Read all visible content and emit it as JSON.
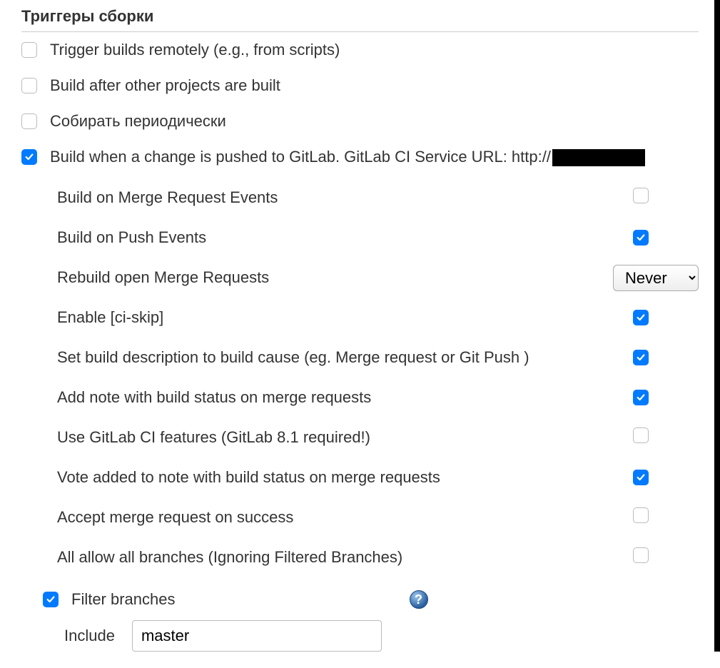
{
  "section_title": "Триггеры сборки",
  "triggers": {
    "remote": {
      "label": "Trigger builds remotely (e.g., from scripts)",
      "checked": false
    },
    "after_projects": {
      "label": "Build after other projects are built",
      "checked": false
    },
    "periodic": {
      "label": "Собирать периодически",
      "checked": false
    },
    "gitlab_push": {
      "label": "Build when a change is pushed to GitLab. GitLab CI Service URL: http://",
      "checked": true
    }
  },
  "gitlab_options": {
    "mr_events": {
      "label": "Build on Merge Request Events",
      "checked": false
    },
    "push_events": {
      "label": "Build on Push Events",
      "checked": true
    },
    "rebuild_mr": {
      "label": "Rebuild open Merge Requests",
      "value": "Never"
    },
    "ci_skip": {
      "label": "Enable [ci-skip]",
      "checked": true
    },
    "build_desc": {
      "label": "Set build description to build cause (eg. Merge request or Git Push )",
      "checked": true
    },
    "add_note": {
      "label": "Add note with build status on merge requests",
      "checked": true
    },
    "use_gitlab_ci": {
      "label": "Use GitLab CI features (GitLab 8.1 required!)",
      "checked": false
    },
    "vote_note": {
      "label": "Vote added to note with build status on merge requests",
      "checked": true
    },
    "accept_mr": {
      "label": "Accept merge request on success",
      "checked": false
    },
    "all_branches": {
      "label": "All allow all branches (Ignoring Filtered Branches)",
      "checked": false
    }
  },
  "filter": {
    "label": "Filter branches",
    "checked": true,
    "include_label": "Include",
    "include_value": "master"
  }
}
